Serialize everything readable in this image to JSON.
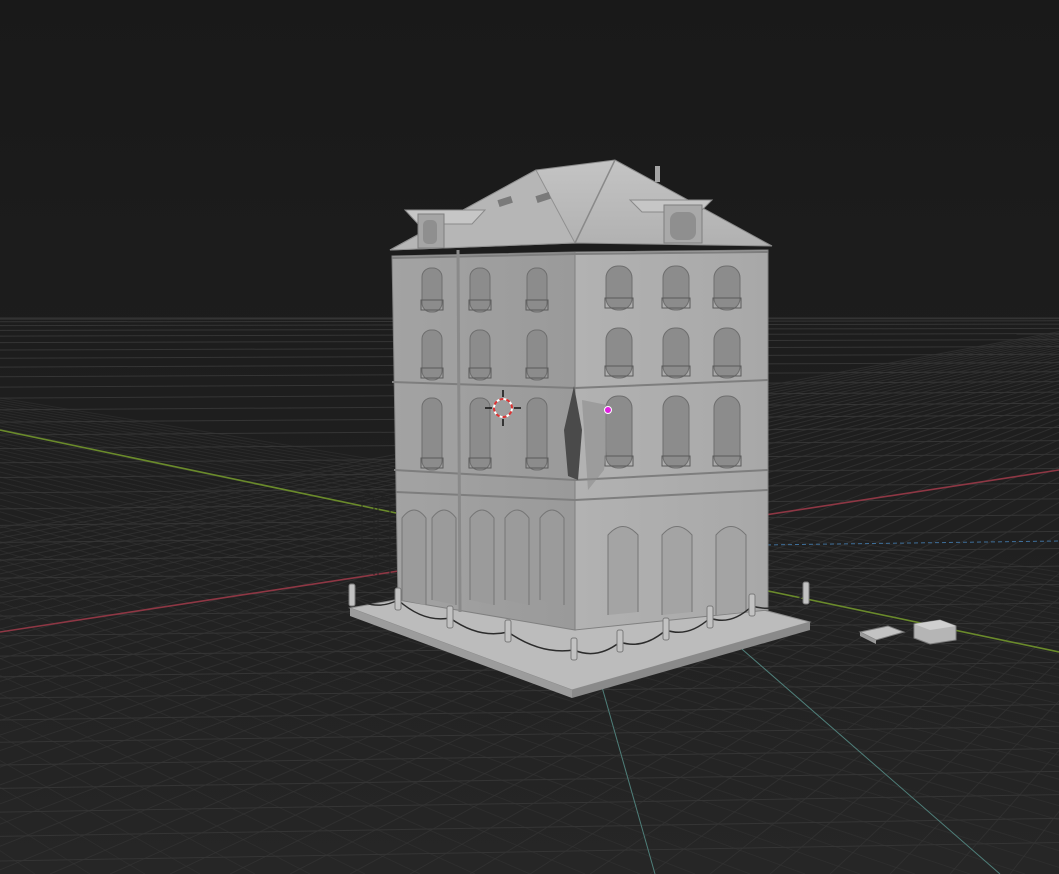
{
  "app": "3D viewport",
  "colors": {
    "background": "#1b1b1b",
    "grid": "#3a3a3a",
    "x_axis": "#9b3a46",
    "y_axis": "#6c8c2a",
    "wall": "#a9a9a9",
    "roof": "#b9b9b9",
    "origin_dot": "#e020e0",
    "cursor_red": "#d33",
    "selection_outline": "#5aa8c8"
  },
  "icons": {
    "cursor": "3d-cursor-icon",
    "origin": "object-origin-icon"
  }
}
